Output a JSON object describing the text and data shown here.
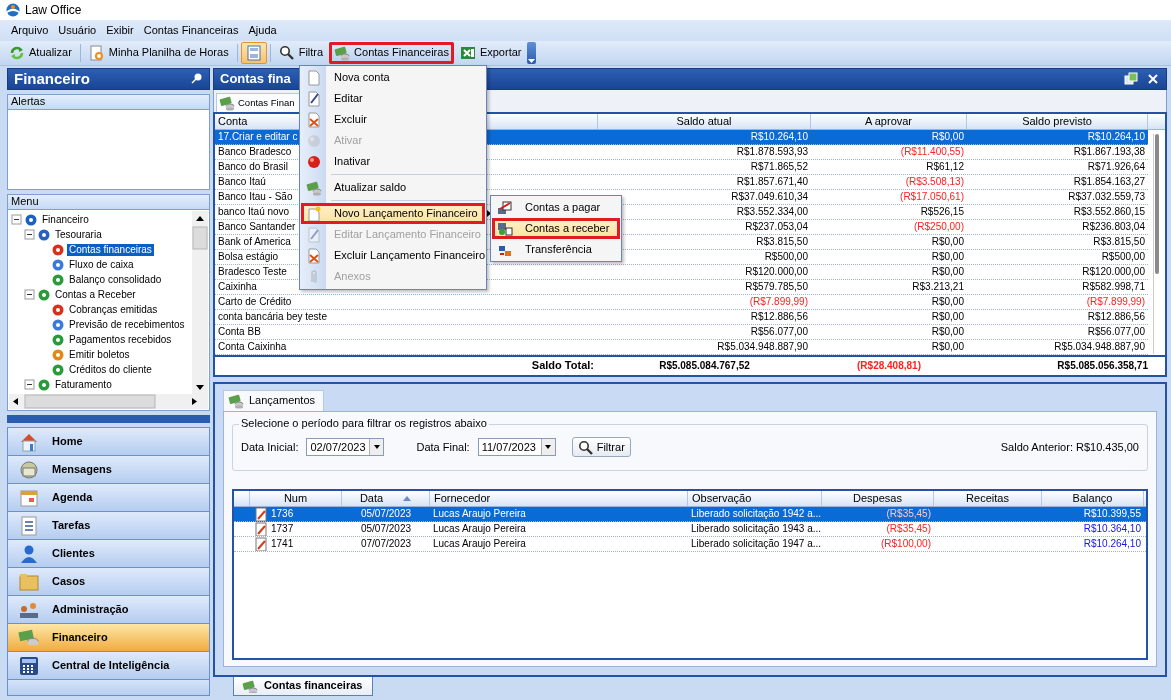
{
  "window": {
    "title": "Law Office"
  },
  "menu_bar": [
    "Arquivo",
    "Usuário",
    "Exibir",
    "Contas Financeiras",
    "Ajuda"
  ],
  "toolbar": [
    {
      "kind": "button",
      "label": "Atualizar",
      "checked": false,
      "annotated": false
    },
    {
      "kind": "separator"
    },
    {
      "kind": "button",
      "label": "Minha Planilha de Horas",
      "checked": false,
      "annotated": false
    },
    {
      "kind": "separator"
    },
    {
      "kind": "icon",
      "checked": true,
      "annotated": false
    },
    {
      "kind": "separator"
    },
    {
      "kind": "button",
      "label": "Filtra",
      "checked": false,
      "annotated": false
    },
    {
      "kind": "button",
      "label": "Contas Financeiras",
      "checked": true,
      "annotated": true
    },
    {
      "kind": "button",
      "label": "Exportar",
      "checked": false,
      "annotated": false
    },
    {
      "kind": "overflow"
    }
  ],
  "sidebar": {
    "title": "Financeiro",
    "alerts_title": "Alertas",
    "menu_title": "Menu",
    "tree": [
      {
        "label": "Financeiro",
        "expanded": true,
        "selected": false,
        "children": [
          {
            "label": "Tesouraria",
            "expanded": true,
            "selected": false,
            "children": [
              {
                "label": "Contas financeiras",
                "selected": true
              },
              {
                "label": "Fluxo de caixa",
                "selected": false
              },
              {
                "label": "Balanço consolidado",
                "selected": false
              }
            ]
          },
          {
            "label": "Contas a Receber",
            "expanded": true,
            "selected": false,
            "children": [
              {
                "label": "Cobranças emitidas",
                "selected": false
              },
              {
                "label": "Previsão de recebimentos",
                "selected": false
              },
              {
                "label": "Pagamentos recebidos",
                "selected": false
              },
              {
                "label": "Emitir boletos",
                "selected": false
              },
              {
                "label": "Créditos do cliente",
                "selected": false
              }
            ]
          },
          {
            "label": "Faturamento",
            "expanded": true,
            "selected": false
          }
        ]
      }
    ],
    "nav": [
      {
        "label": "Home",
        "selected": false
      },
      {
        "label": "Mensagens",
        "selected": false
      },
      {
        "label": "Agenda",
        "selected": false
      },
      {
        "label": "Tarefas",
        "selected": false
      },
      {
        "label": "Clientes",
        "selected": false
      },
      {
        "label": "Casos",
        "selected": false
      },
      {
        "label": "Administração",
        "selected": false
      },
      {
        "label": "Financeiro",
        "selected": true
      },
      {
        "label": "Central de Inteligência",
        "selected": false
      }
    ]
  },
  "accounts_panel": {
    "title": "Contas fina",
    "tab": "Contas Finan",
    "columns": [
      "Conta",
      "Saldo atual",
      "A aprovar",
      "Saldo previsto"
    ],
    "rows": [
      {
        "conta": "17.Criar e editar c",
        "values": [
          "R$10.264,10",
          "R$0,00",
          "R$10.264,10"
        ],
        "negative": [
          false,
          false,
          false
        ],
        "selected": true
      },
      {
        "conta": "Banco Bradesco",
        "values": [
          "R$1.878.593,93",
          "(R$11.400,55)",
          "R$1.867.193,38"
        ],
        "negative": [
          false,
          true,
          false
        ],
        "selected": false
      },
      {
        "conta": "Banco do Brasil",
        "values": [
          "R$71.865,52",
          "R$61,12",
          "R$71.926,64"
        ],
        "negative": [
          false,
          false,
          false
        ],
        "selected": false
      },
      {
        "conta": "Banco Itaú",
        "values": [
          "R$1.857.671,40",
          "(R$3.508,13)",
          "R$1.854.163,27"
        ],
        "negative": [
          false,
          true,
          false
        ],
        "selected": false
      },
      {
        "conta": "Banco Itau - São",
        "values": [
          "R$37.049.610,34",
          "(R$17.050,61)",
          "R$37.032.559,73"
        ],
        "negative": [
          false,
          true,
          false
        ],
        "selected": false
      },
      {
        "conta": "banco Itaú novo",
        "values": [
          "R$3.552.334,00",
          "R$526,15",
          "R$3.552.860,15"
        ],
        "negative": [
          false,
          false,
          false
        ],
        "selected": false
      },
      {
        "conta": "Banco Santander",
        "values": [
          "R$237.053,04",
          "(R$250,00)",
          "R$236.803,04"
        ],
        "negative": [
          false,
          true,
          false
        ],
        "selected": false
      },
      {
        "conta": "Bank of America",
        "values": [
          "R$3.815,50",
          "R$0,00",
          "R$3.815,50"
        ],
        "negative": [
          false,
          false,
          false
        ],
        "selected": false
      },
      {
        "conta": "Bolsa estágio",
        "values": [
          "R$500,00",
          "R$0,00",
          "R$500,00"
        ],
        "negative": [
          false,
          false,
          false
        ],
        "selected": false
      },
      {
        "conta": "Bradesco Teste",
        "values": [
          "R$120.000,00",
          "R$0,00",
          "R$120.000,00"
        ],
        "negative": [
          false,
          false,
          false
        ],
        "selected": false
      },
      {
        "conta": "Caixinha",
        "values": [
          "R$579.785,50",
          "R$3.213,21",
          "R$582.998,71"
        ],
        "negative": [
          false,
          false,
          false
        ],
        "selected": false
      },
      {
        "conta": "Carto de Crédito",
        "values": [
          "(R$7.899,99)",
          "R$0,00",
          "(R$7.899,99)"
        ],
        "negative": [
          true,
          false,
          true
        ],
        "selected": false
      },
      {
        "conta": "conta bancária bey teste",
        "values": [
          "R$12.886,56",
          "R$0,00",
          "R$12.886,56"
        ],
        "negative": [
          false,
          false,
          false
        ],
        "selected": false
      },
      {
        "conta": "Conta BB",
        "values": [
          "R$56.077,00",
          "R$0,00",
          "R$56.077,00"
        ],
        "negative": [
          false,
          false,
          false
        ],
        "selected": false
      },
      {
        "conta": "Conta Caixinha",
        "values": [
          "R$5.034.948.887,90",
          "R$0,00",
          "R$5.034.948.887,90"
        ],
        "negative": [
          false,
          false,
          false
        ],
        "selected": false
      }
    ],
    "total": {
      "label": "Saldo Total:",
      "values": [
        "R$5.085.084.767,52",
        "(R$28.408,81)",
        "R$5.085.056.358,71"
      ],
      "negative": [
        false,
        true,
        false
      ]
    }
  },
  "context_menu": [
    {
      "kind": "item",
      "label": "Nova conta",
      "disabled": false,
      "selected": false,
      "annotated": false
    },
    {
      "kind": "item",
      "label": "Editar",
      "disabled": false,
      "selected": false,
      "annotated": false
    },
    {
      "kind": "item",
      "label": "Excluir",
      "disabled": false,
      "selected": false,
      "annotated": false
    },
    {
      "kind": "item",
      "label": "Ativar",
      "disabled": true,
      "selected": false,
      "annotated": false
    },
    {
      "kind": "item",
      "label": "Inativar",
      "disabled": false,
      "selected": false,
      "annotated": false
    },
    {
      "kind": "separator"
    },
    {
      "kind": "item",
      "label": "Atualizar saldo",
      "disabled": false,
      "selected": false,
      "annotated": false
    },
    {
      "kind": "separator"
    },
    {
      "kind": "submenu",
      "label": "Novo Lançamento Financeiro",
      "disabled": false,
      "selected": true,
      "annotated": true
    },
    {
      "kind": "item",
      "label": "Editar Lançamento Financeiro",
      "disabled": true,
      "selected": false,
      "annotated": false
    },
    {
      "kind": "item",
      "label": "Excluir Lançamento Financeiro",
      "disabled": false,
      "selected": false,
      "annotated": false
    },
    {
      "kind": "item",
      "label": "Anexos",
      "disabled": true,
      "selected": false,
      "annotated": false
    }
  ],
  "submenu": [
    {
      "label": "Contas a pagar",
      "selected": false,
      "annotated": false
    },
    {
      "label": "Contas a receber",
      "selected": true,
      "annotated": true
    },
    {
      "label": "Transferência",
      "selected": false,
      "annotated": false
    }
  ],
  "entries_panel": {
    "tab": "Lançamentos",
    "filter": {
      "legend": "Selecione o período para filtrar os registros abaixo",
      "start_label": "Data Inicial:",
      "start_value": "02/07/2023",
      "end_label": "Data Final:",
      "end_value": "11/07/2023",
      "button": "Filtrar",
      "previous_balance": "Saldo Anterior: R$10.435,00"
    },
    "columns": [
      "Num",
      "Data",
      "Fornecedor",
      "Observação",
      "Despesas",
      "Receitas",
      "Balanço"
    ],
    "rows": [
      {
        "num": "1736",
        "data": "05/07/2023",
        "fornecedor": "Lucas Araujo Pereira",
        "observacao": "Liberado solicitação 1942 a...",
        "despesas": "(R$35,45)",
        "balanco": "R$10.399,55",
        "selected": true
      },
      {
        "num": "1737",
        "data": "05/07/2023",
        "fornecedor": "Lucas Araujo Pereira",
        "observacao": "Liberado solicitação 1943 a...",
        "despesas": "(R$35,45)",
        "balanco": "R$10.364,10",
        "selected": false
      },
      {
        "num": "1741",
        "data": "07/07/2023",
        "fornecedor": "Lucas Araujo Pereira",
        "observacao": "Liberado solicitação 1947 a...",
        "despesas": "(R$100,00)",
        "balanco": "R$10.264,10",
        "selected": false
      }
    ]
  },
  "bottom_tabs": [
    {
      "label": "Contas financeiras",
      "selected": true
    }
  ]
}
